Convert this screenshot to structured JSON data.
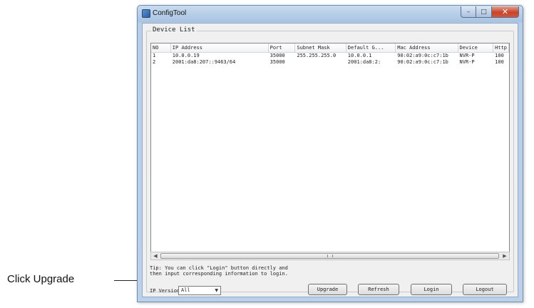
{
  "annotation": {
    "text": "Click Upgrade"
  },
  "window": {
    "title": "ConfigTool"
  },
  "titlebar": {
    "minimize_glyph": "–",
    "maximize_glyph": "□",
    "close_glyph": "✕"
  },
  "device_list": {
    "legend": "Device List",
    "columns": [
      "NO",
      "IP Address",
      "Port",
      "Subnet Mask",
      "Default G...",
      "Mac Address",
      "Device",
      "Http"
    ],
    "rows": [
      [
        "1",
        "10.0.0.19",
        "35000",
        "255.255.255.0",
        "10.0.0.1",
        "90:02:a9:0c:c7:1b",
        "NVR-P",
        "100"
      ],
      [
        "2",
        "2001:da8:207::9463/64",
        "35000",
        "",
        "2001:da8:2:",
        "90:02:a9:0c:c7:1b",
        "NVR-P",
        "100"
      ]
    ]
  },
  "tip": {
    "line1": "Tip: You can click \"Login\" button directly and",
    "line2": "then input corresponding information to login."
  },
  "ip_version": {
    "label": "IP Version",
    "selected": "All"
  },
  "buttons": {
    "upgrade": "Upgrade",
    "refresh": "Refresh",
    "login": "Login",
    "logout": "Logout"
  },
  "icons": {
    "app": "app-icon",
    "scroll_left": "arrow-left-icon",
    "scroll_right": "arrow-right-icon",
    "dropdown": "chevron-down-icon"
  },
  "colors": {
    "titlebar": "#a9c3e1",
    "close_button": "#c7442b",
    "client_bg": "#f0f0f0"
  }
}
